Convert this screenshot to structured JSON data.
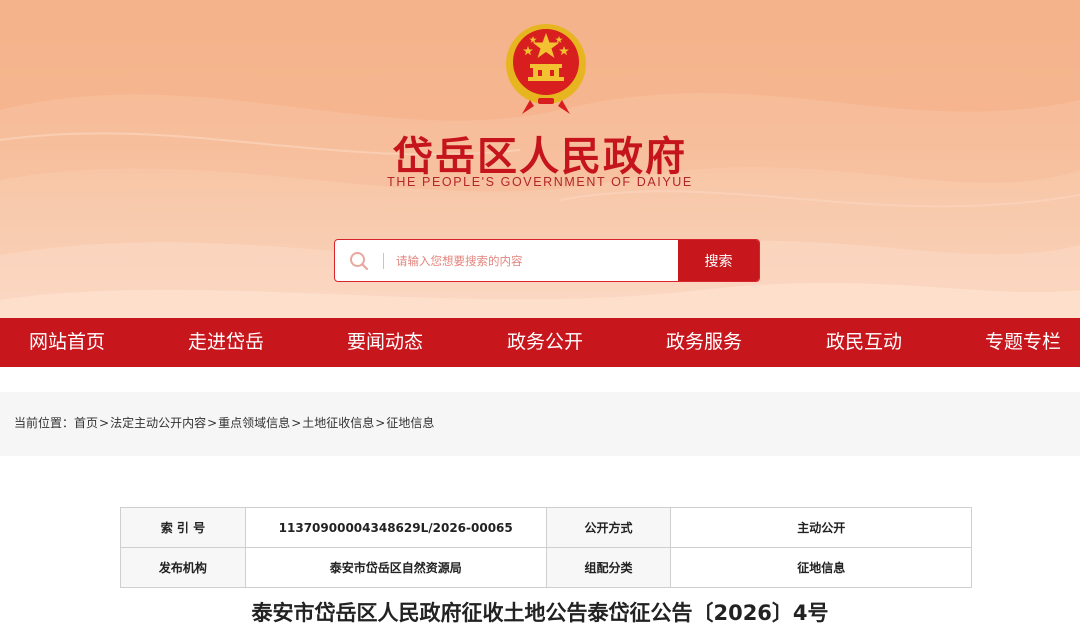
{
  "header": {
    "title": "岱岳区人民政府",
    "subtitle": "THE PEOPLE'S GOVERNMENT OF DAIYUE",
    "emblem_icon": "national-emblem-icon"
  },
  "search": {
    "placeholder": "请输入您想要搜索的内容",
    "button_label": "搜索",
    "icon": "search-icon"
  },
  "nav": {
    "items": [
      {
        "label": "网站首页"
      },
      {
        "label": "走进岱岳"
      },
      {
        "label": "要闻动态"
      },
      {
        "label": "政务公开"
      },
      {
        "label": "政务服务"
      },
      {
        "label": "政民互动"
      },
      {
        "label": "专题专栏"
      }
    ]
  },
  "breadcrumb": {
    "prefix": "当前位置：",
    "items": [
      "首页",
      "法定主动公开内容",
      "重点领域信息",
      "土地征收信息",
      "征地信息"
    ],
    "separator": ">"
  },
  "info_table": {
    "rows": [
      [
        {
          "label": "索 引 号",
          "value": "11370900004348629L/2026-00065"
        },
        {
          "label": "公开方式",
          "value": "主动公开"
        }
      ],
      [
        {
          "label": "发布机构",
          "value": "泰安市岱岳区自然资源局"
        },
        {
          "label": "组配分类",
          "value": "征地信息"
        }
      ]
    ]
  },
  "document": {
    "title": "泰安市岱岳区人民政府征收土地公告泰岱征公告〔2026〕4号"
  },
  "colors": {
    "brand_red": "#c8161d",
    "title_red": "#c6141c",
    "banner_peach": "#f8c4a3"
  }
}
